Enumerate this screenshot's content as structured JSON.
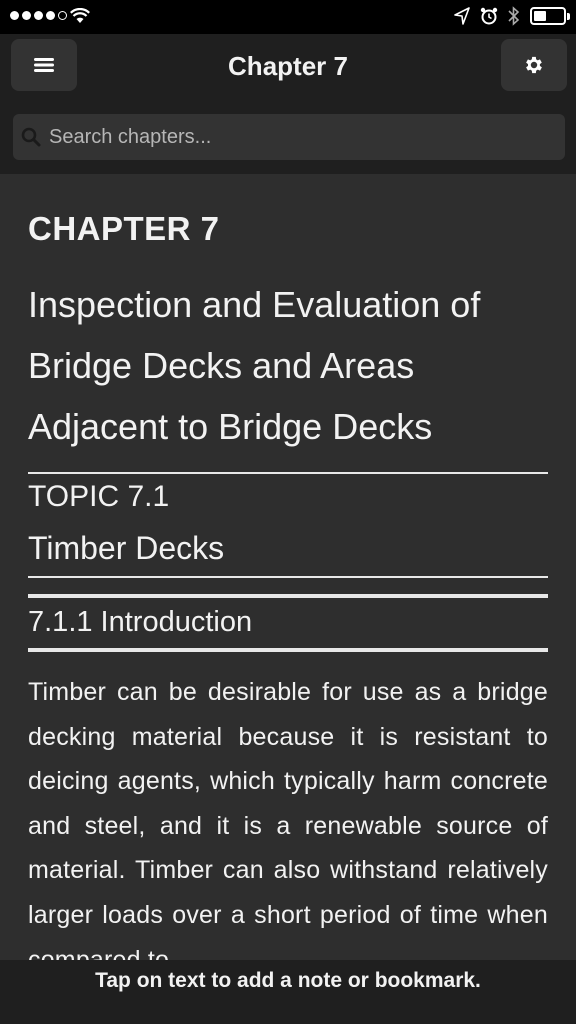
{
  "status_bar": {
    "signal_icon": "signal-dots-icon",
    "wifi_icon": "wifi-icon",
    "location_icon": "location-arrow-icon",
    "alarm_icon": "alarm-clock-icon",
    "bluetooth_icon": "bluetooth-icon",
    "battery_icon": "battery-icon",
    "battery_level": 0.35
  },
  "header": {
    "title": "Chapter 7",
    "menu_icon": "hamburger-menu-icon",
    "settings_icon": "gear-icon"
  },
  "search": {
    "placeholder": "Search chapters...",
    "value": "",
    "icon": "search-icon"
  },
  "content": {
    "chapter_label": "CHAPTER 7",
    "chapter_title": "Inspection and Evaluation of Bridge Decks and Areas Adjacent to Bridge Decks",
    "topic_label": "TOPIC 7.1",
    "topic_title": "Timber Decks",
    "section_title": "7.1.1 Introduction",
    "paragraph": "Timber can be desirable for use as a bridge decking material because it is resistant to deicing agents, which typically harm concrete and steel, and it is a renewable source of material. Timber can also withstand relatively larger loads over a short period of time when compared to"
  },
  "footer": {
    "hint": "Tap on text to add a note or bookmark."
  },
  "colors": {
    "background": "#2e2e2e",
    "header_bg": "#1f1f1f",
    "button_bg": "#333333",
    "text": "#f2f2f2"
  }
}
